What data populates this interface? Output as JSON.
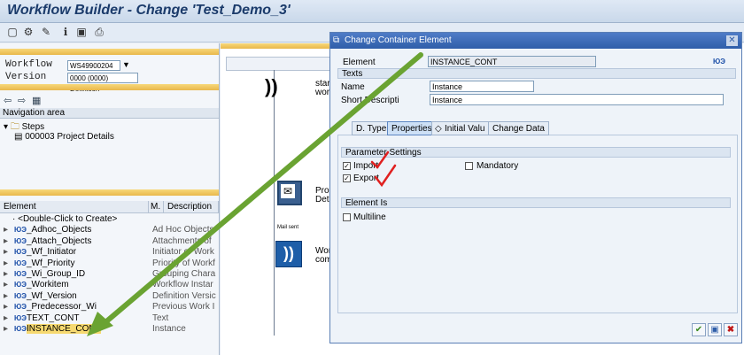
{
  "window": {
    "title": "Workflow Builder - Change 'Test_Demo_3'"
  },
  "toolbar": {
    "icons": [
      "new-icon",
      "settings-icon",
      "tools-icon",
      "info-icon",
      "screen-icon",
      "print-icon"
    ]
  },
  "left": {
    "workflow_label": "Workflow",
    "workflow_value": "WS49900204",
    "version_label": "Version",
    "version_value": "0000 (0000) Definition",
    "navigation_title": "Navigation area",
    "steps_label": "Steps",
    "step_item": "000003 Project Details",
    "columns": {
      "element": "Element",
      "m": "M.",
      "description": "Description"
    },
    "rows": [
      {
        "element": "<Double-Click to Create>",
        "description": ""
      },
      {
        "element": "_Adhoc_Objects",
        "description": "Ad Hoc Objects"
      },
      {
        "element": "_Attach_Objects",
        "description": "Attachments of"
      },
      {
        "element": "_Wf_Initiator",
        "description": "Initiator of Work"
      },
      {
        "element": "_Wf_Priority",
        "description": "Priority of Workf"
      },
      {
        "element": "_Wi_Group_ID",
        "description": "Grouping Chara"
      },
      {
        "element": "_Workitem",
        "description": "Workflow Instar"
      },
      {
        "element": "_Wf_Version",
        "description": "Definition Versic"
      },
      {
        "element": "_Predecessor_Wi",
        "description": "Previous Work I"
      },
      {
        "element": "TEXT_CONT",
        "description": "Text"
      },
      {
        "element": "INSTANCE_CONT",
        "description": "Instance"
      }
    ]
  },
  "canvas": {
    "start_text_1": "star",
    "start_text_2": "work",
    "step_text_1": "Prop",
    "step_text_2": "Deta",
    "step_caption": "Mail sent",
    "end_text_1": "Wor",
    "end_text_2": "com"
  },
  "dialog": {
    "title": "Change Container Element",
    "element_label": "Element",
    "element_value": "INSTANCE_CONT",
    "texts_title": "Texts",
    "name_label": "Name",
    "name_value": "Instance",
    "short_desc_label": "Short Descripti",
    "short_desc_value": "Instance",
    "tabs": [
      "D. Type",
      "Properties",
      "Initial Valu",
      "Change Data"
    ],
    "param_title": "Parameter Settings",
    "import_label": "Import",
    "mandatory_label": "Mandatory",
    "export_label": "Export",
    "element_is_title": "Element Is",
    "multiline_label": "Multiline",
    "import_checked": true,
    "export_checked": true,
    "mandatory_checked": false,
    "multiline_checked": false
  },
  "colors": {
    "accent": "#2f5ea9",
    "arrow": "#6aa332",
    "annotation": "#e02020",
    "highlight": "#f6d970"
  }
}
